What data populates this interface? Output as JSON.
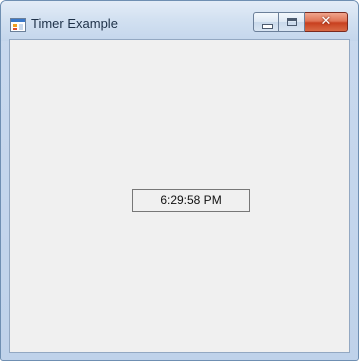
{
  "window": {
    "title": "Timer Example",
    "icon": "winforms-app-icon",
    "caption_buttons": [
      {
        "name": "minimize",
        "icon": "minimize-icon"
      },
      {
        "name": "maximize",
        "icon": "maximize-icon"
      },
      {
        "name": "close",
        "icon": "close-icon",
        "glyph": "✕"
      }
    ]
  },
  "form": {
    "time_label": "6:29:58 PM"
  },
  "colors": {
    "title_text": "#1e3148",
    "client_background": "#f0f0f0",
    "close_button": "#c8401f",
    "frame": "#c9d9ee"
  }
}
